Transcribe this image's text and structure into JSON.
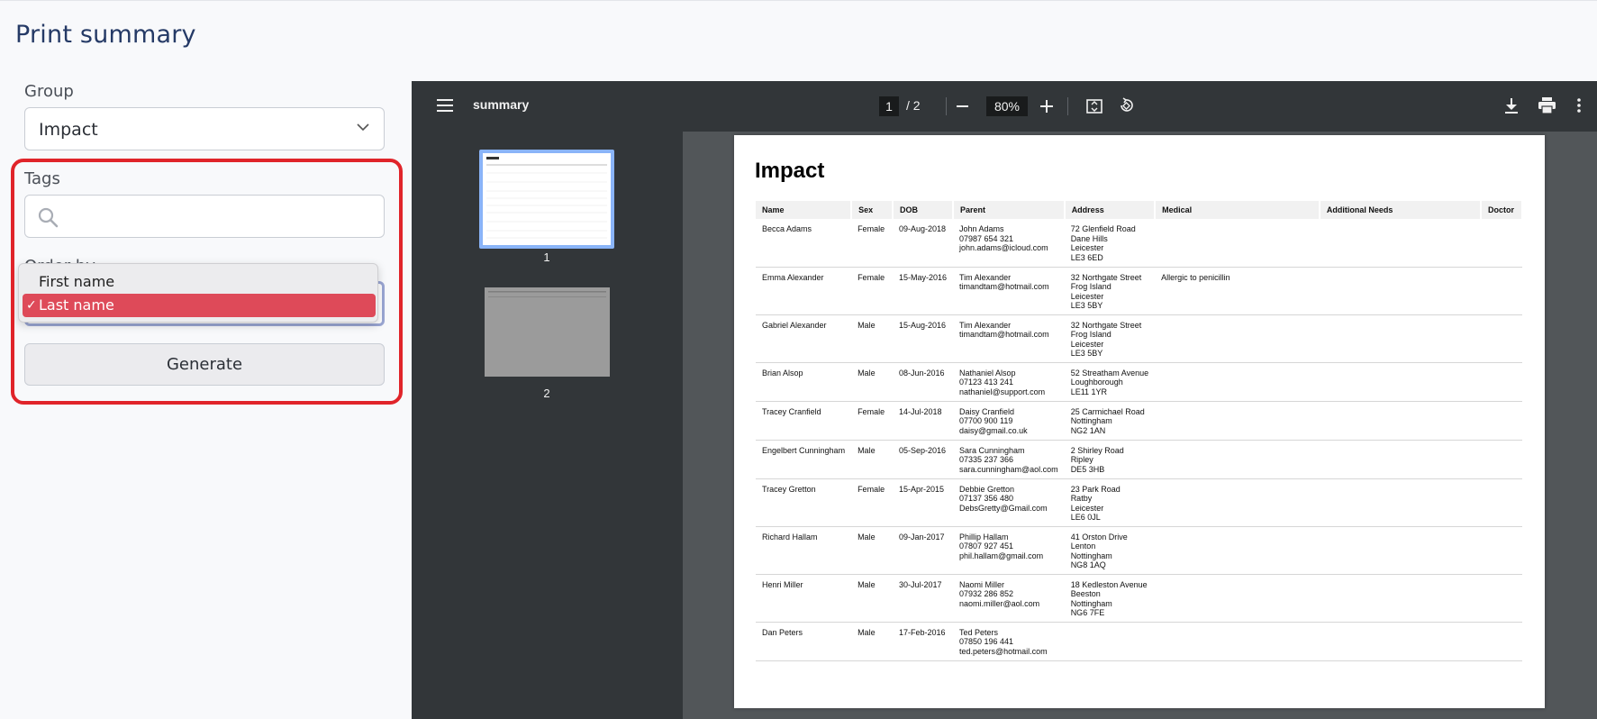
{
  "page_title": "Print summary",
  "group": {
    "label": "Group",
    "value": "Impact"
  },
  "tags": {
    "label": "Tags",
    "placeholder": ""
  },
  "order": {
    "label": "Order by",
    "options": [
      "First name",
      "Last name"
    ],
    "selected": "Last name",
    "check": "✓"
  },
  "generate_label": "Generate",
  "viewer": {
    "doc_name": "summary",
    "page_current": "1",
    "page_total": "/  2",
    "zoom": "80%",
    "thumb_labels": [
      "1",
      "2"
    ],
    "icons": [
      "menu-icon",
      "zoom-out-icon",
      "zoom-in-icon",
      "fit-page-icon",
      "rotate-icon",
      "download-icon",
      "print-icon",
      "more-icon"
    ]
  },
  "document": {
    "title": "Impact",
    "columns": [
      "Name",
      "Sex",
      "DOB",
      "Parent",
      "Address",
      "Medical",
      "Additional Needs",
      "Doctor"
    ],
    "rows": [
      {
        "name": "Becca Adams",
        "sex": "Female",
        "dob": "09-Aug-2018",
        "parent": [
          "John Adams",
          "07987 654 321",
          "john.adams@icloud.com"
        ],
        "address": [
          "72 Glenfield Road",
          "Dane Hills",
          "Leicester",
          "LE3 6ED"
        ],
        "medical": ""
      },
      {
        "name": "Emma Alexander",
        "sex": "Female",
        "dob": "15-May-2016",
        "parent": [
          "Tim Alexander",
          "timandtam@hotmail.com"
        ],
        "address": [
          "32 Northgate Street",
          "Frog Island",
          "Leicester",
          "LE3 5BY"
        ],
        "medical": "Allergic to penicillin"
      },
      {
        "name": "Gabriel Alexander",
        "sex": "Male",
        "dob": "15-Aug-2016",
        "parent": [
          "Tim Alexander",
          "timandtam@hotmail.com"
        ],
        "address": [
          "32 Northgate Street",
          "Frog Island",
          "Leicester",
          "LE3 5BY"
        ],
        "medical": ""
      },
      {
        "name": "Brian Alsop",
        "sex": "Male",
        "dob": "08-Jun-2016",
        "parent": [
          "Nathaniel Alsop",
          "07123 413 241",
          "nathaniel@support.com"
        ],
        "address": [
          "52 Streatham Avenue",
          "Loughborough",
          "LE11 1YR"
        ],
        "medical": ""
      },
      {
        "name": "Tracey Cranfield",
        "sex": "Female",
        "dob": "14-Jul-2018",
        "parent": [
          "Daisy Cranfield",
          "07700 900 119",
          "daisy@gmail.co.uk"
        ],
        "address": [
          "25 Carmichael Road",
          "Nottingham",
          "NG2 1AN"
        ],
        "medical": ""
      },
      {
        "name": "Engelbert Cunningham",
        "sex": "Male",
        "dob": "05-Sep-2016",
        "parent": [
          "Sara Cunningham",
          "07335 237 366",
          "sara.cunningham@aol.com"
        ],
        "address": [
          "2 Shirley Road",
          "Ripley",
          "DE5 3HB"
        ],
        "medical": ""
      },
      {
        "name": "Tracey Gretton",
        "sex": "Female",
        "dob": "15-Apr-2015",
        "parent": [
          "Debbie Gretton",
          "07137 356 480",
          "DebsGretty@Gmail.com"
        ],
        "address": [
          "23 Park Road",
          "Ratby",
          "Leicester",
          "LE6 0JL"
        ],
        "medical": ""
      },
      {
        "name": "Richard Hallam",
        "sex": "Male",
        "dob": "09-Jan-2017",
        "parent": [
          "Phillip Hallam",
          "07807 927 451",
          "phil.hallam@gmail.com"
        ],
        "address": [
          "41 Orston Drive",
          "Lenton",
          "Nottingham",
          "NG8 1AQ"
        ],
        "medical": ""
      },
      {
        "name": "Henri Miller",
        "sex": "Male",
        "dob": "30-Jul-2017",
        "parent": [
          "Naomi Miller",
          "07932 286 852",
          "naomi.miller@aol.com"
        ],
        "address": [
          "18 Kedleston Avenue",
          "Beeston",
          "Nottingham",
          "NG6 7FE"
        ],
        "medical": ""
      },
      {
        "name": "Dan Peters",
        "sex": "Male",
        "dob": "17-Feb-2016",
        "parent": [
          "Ted Peters",
          "07850 196 441",
          "ted.peters@hotmail.com"
        ],
        "address": [],
        "medical": ""
      }
    ]
  },
  "colors": {
    "accent": "#e0242a",
    "selected": "#de4a59",
    "title": "#253a66"
  }
}
